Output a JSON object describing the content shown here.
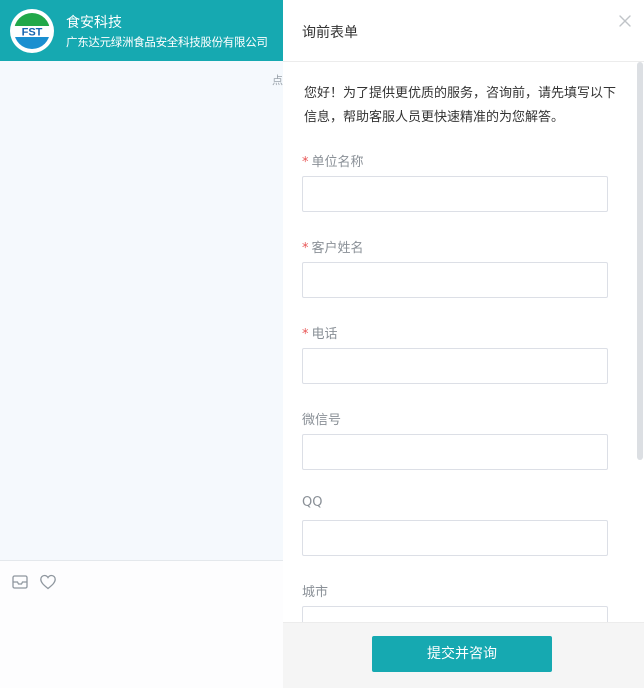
{
  "chat": {
    "brand_name": "食安科技",
    "brand_sub": "广东达元绿洲食品安全科技股份有限公司",
    "logo_text": "FST",
    "hint": "点"
  },
  "form": {
    "title": "询前表单",
    "intro": "您好！为了提供更优质的服务，咨询前，请先填写以下信息，帮助客服人员更快速精准的为您解答。",
    "required_mark": "*",
    "fields": [
      {
        "label": "单位名称",
        "required": true,
        "value": ""
      },
      {
        "label": "客户姓名",
        "required": true,
        "value": ""
      },
      {
        "label": "电话",
        "required": true,
        "value": ""
      },
      {
        "label": "微信号",
        "required": false,
        "value": ""
      },
      {
        "label": "QQ",
        "required": false,
        "value": ""
      },
      {
        "label": "城市",
        "required": false,
        "value": ""
      }
    ],
    "submit_label": "提交并咨询"
  },
  "colors": {
    "accent": "#16a9b1",
    "required": "#e85555"
  },
  "icons": {
    "close": "close-icon",
    "message": "envelope-icon",
    "favorite": "heart-icon"
  }
}
